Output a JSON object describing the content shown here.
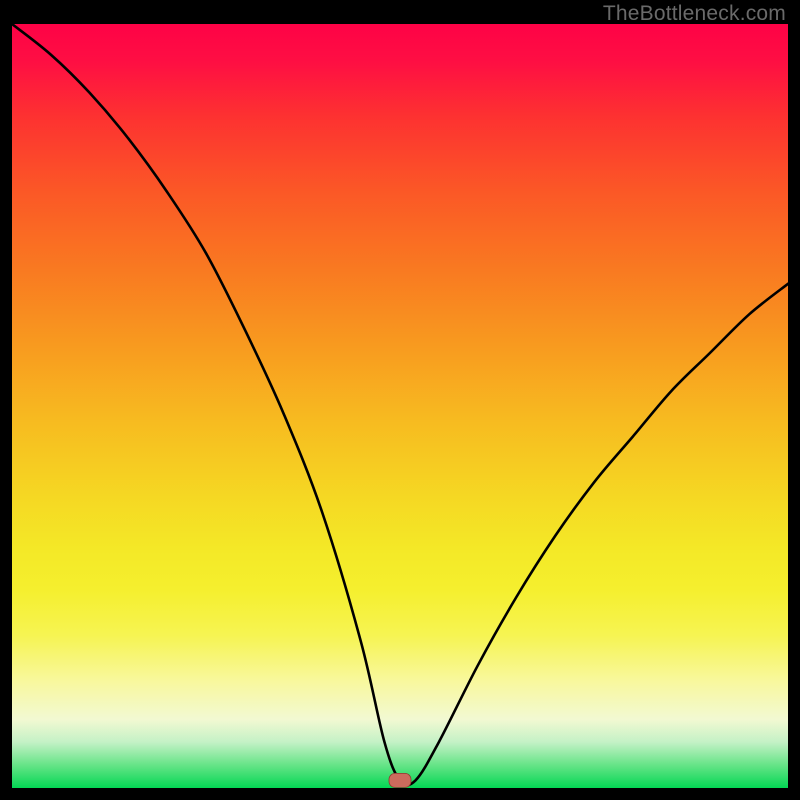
{
  "attribution": "TheBottleneck.com",
  "chart_data": {
    "type": "line",
    "title": "",
    "xlabel": "",
    "ylabel": "",
    "xlim": [
      0,
      100
    ],
    "ylim": [
      0,
      100
    ],
    "series": [
      {
        "name": "bottleneck-curve",
        "x": [
          0,
          5,
          10,
          15,
          20,
          25,
          30,
          35,
          40,
          45,
          48,
          50,
          52,
          55,
          60,
          65,
          70,
          75,
          80,
          85,
          90,
          95,
          100
        ],
        "y": [
          100,
          96,
          91,
          85,
          78,
          70,
          60,
          49,
          36,
          19,
          6,
          1,
          1,
          6,
          16,
          25,
          33,
          40,
          46,
          52,
          57,
          62,
          66
        ]
      }
    ],
    "marker": {
      "x": 50,
      "y": 1,
      "shape": "rounded-rect",
      "color": "#cc6b5d"
    },
    "background": {
      "type": "vertical-gradient",
      "stops": [
        {
          "pos": 0.0,
          "color": "#fe0246"
        },
        {
          "pos": 0.32,
          "color": "#f97921"
        },
        {
          "pos": 0.62,
          "color": "#f5d823"
        },
        {
          "pos": 0.86,
          "color": "#f8f89d"
        },
        {
          "pos": 1.0,
          "color": "#04d754"
        }
      ]
    }
  }
}
